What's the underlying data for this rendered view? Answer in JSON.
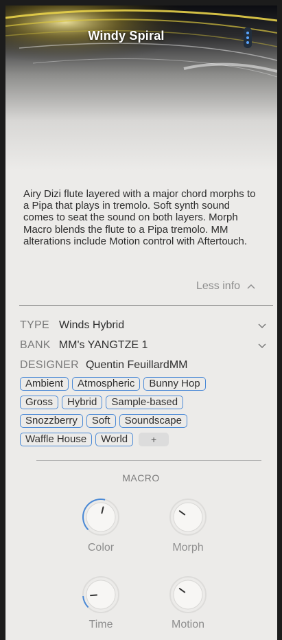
{
  "header": {
    "title": "Windy Spiral",
    "menu_icon": "vertical-dots-icon",
    "accent": "#4a89d6"
  },
  "description": "Airy Dizi flute layered with a major chord morphs to a Pipa that plays in tremolo. Soft synth sound comes to seat the sound on both layers. Morph Macro blends the flute to a Pipa tremolo. MM alterations include Motion control with Aftertouch.",
  "less_info": "Less info",
  "meta": {
    "type_label": "TYPE",
    "type_value": "Winds Hybrid",
    "bank_label": "BANK",
    "bank_value": "MM's YANGTZE 1",
    "designer_label": "DESIGNER",
    "designer_value": "Quentin FeuillardMM"
  },
  "tags": [
    "Ambient",
    "Atmospheric",
    "Bunny Hop",
    "Gross",
    "Hybrid",
    "Sample-based",
    "Snozzberry",
    "Soft",
    "Soundscape",
    "Waffle House",
    "World"
  ],
  "add_tag": "+",
  "macro": {
    "title": "MACRO",
    "knobs": [
      {
        "label": "Color",
        "value": 0.55,
        "active": true
      },
      {
        "label": "Morph",
        "value": 0.3,
        "active": false
      },
      {
        "label": "Time",
        "value": 0.15,
        "active": true
      },
      {
        "label": "Motion",
        "value": 0.3,
        "active": false
      }
    ]
  }
}
